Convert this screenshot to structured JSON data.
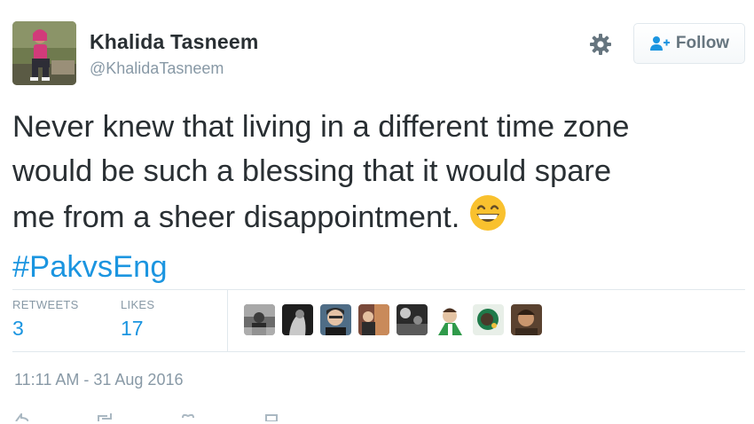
{
  "user": {
    "name": "Khalida Tasneem",
    "handle": "@KhalidaTasneem"
  },
  "header": {
    "follow_label": "Follow",
    "settings_icon": "gear-icon",
    "follow_icon": "add-user-icon"
  },
  "tweet": {
    "lines": [
      "Never knew that living in a different time zone",
      "would be such a blessing that it would spare",
      "me from a sheer disappointment."
    ],
    "emoji": "grinning-face-emoji",
    "hashtag": "#PakvsEng"
  },
  "stats": {
    "retweets_label": "RETWEETS",
    "retweets_value": "3",
    "likes_label": "LIKES",
    "likes_value": "17"
  },
  "likers_count": 8,
  "timestamp": "11:11 AM - 31 Aug 2016",
  "colors": {
    "link": "#1b95e0",
    "muted": "#8899a6",
    "text": "#292f33",
    "border": "#e1e8ed"
  }
}
